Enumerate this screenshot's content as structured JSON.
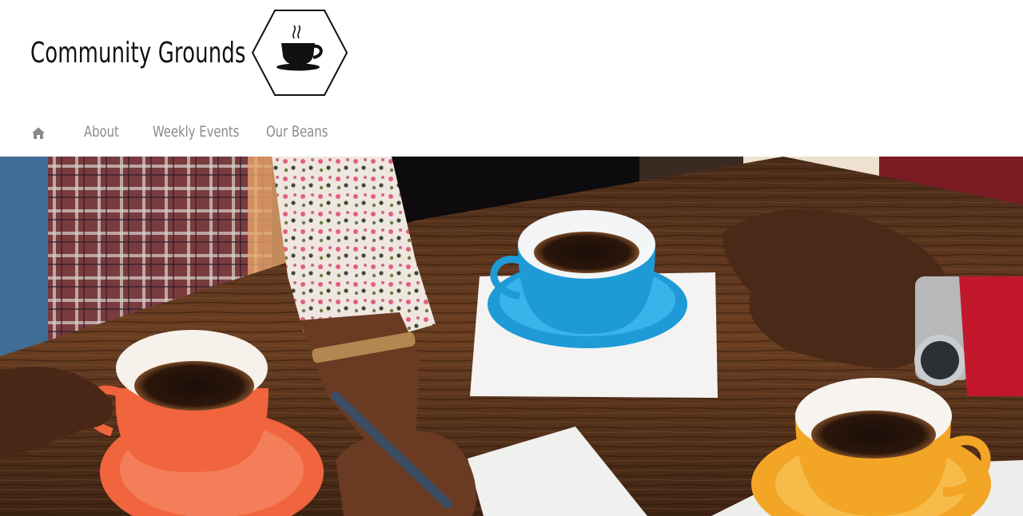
{
  "site": {
    "title": "Community Grounds",
    "logo_icon": "coffee-cup-hexagon-icon"
  },
  "nav": {
    "home_icon": "home-icon",
    "items": [
      {
        "label": "About"
      },
      {
        "label": "Weekly Events"
      },
      {
        "label": "Our Beans"
      }
    ]
  },
  "hero": {
    "image": "people-with-coffee-cups-on-wooden-table",
    "colors": {
      "table": "#5a3520",
      "orange_cup": "#f0643e",
      "blue_cup": "#1e9bd7",
      "yellow_cup": "#f3a526"
    }
  }
}
